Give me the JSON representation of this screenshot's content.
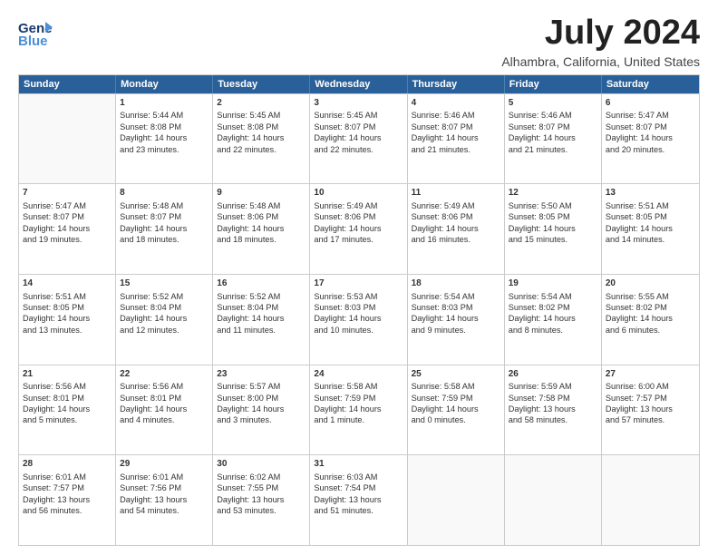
{
  "logo": {
    "line1": "General",
    "line2": "Blue"
  },
  "title": "July 2024",
  "subtitle": "Alhambra, California, United States",
  "days": [
    "Sunday",
    "Monday",
    "Tuesday",
    "Wednesday",
    "Thursday",
    "Friday",
    "Saturday"
  ],
  "weeks": [
    [
      {
        "day": "",
        "content": ""
      },
      {
        "day": "1",
        "content": "Sunrise: 5:44 AM\nSunset: 8:08 PM\nDaylight: 14 hours\nand 23 minutes."
      },
      {
        "day": "2",
        "content": "Sunrise: 5:45 AM\nSunset: 8:08 PM\nDaylight: 14 hours\nand 22 minutes."
      },
      {
        "day": "3",
        "content": "Sunrise: 5:45 AM\nSunset: 8:07 PM\nDaylight: 14 hours\nand 22 minutes."
      },
      {
        "day": "4",
        "content": "Sunrise: 5:46 AM\nSunset: 8:07 PM\nDaylight: 14 hours\nand 21 minutes."
      },
      {
        "day": "5",
        "content": "Sunrise: 5:46 AM\nSunset: 8:07 PM\nDaylight: 14 hours\nand 21 minutes."
      },
      {
        "day": "6",
        "content": "Sunrise: 5:47 AM\nSunset: 8:07 PM\nDaylight: 14 hours\nand 20 minutes."
      }
    ],
    [
      {
        "day": "7",
        "content": "Sunrise: 5:47 AM\nSunset: 8:07 PM\nDaylight: 14 hours\nand 19 minutes."
      },
      {
        "day": "8",
        "content": "Sunrise: 5:48 AM\nSunset: 8:07 PM\nDaylight: 14 hours\nand 18 minutes."
      },
      {
        "day": "9",
        "content": "Sunrise: 5:48 AM\nSunset: 8:06 PM\nDaylight: 14 hours\nand 18 minutes."
      },
      {
        "day": "10",
        "content": "Sunrise: 5:49 AM\nSunset: 8:06 PM\nDaylight: 14 hours\nand 17 minutes."
      },
      {
        "day": "11",
        "content": "Sunrise: 5:49 AM\nSunset: 8:06 PM\nDaylight: 14 hours\nand 16 minutes."
      },
      {
        "day": "12",
        "content": "Sunrise: 5:50 AM\nSunset: 8:05 PM\nDaylight: 14 hours\nand 15 minutes."
      },
      {
        "day": "13",
        "content": "Sunrise: 5:51 AM\nSunset: 8:05 PM\nDaylight: 14 hours\nand 14 minutes."
      }
    ],
    [
      {
        "day": "14",
        "content": "Sunrise: 5:51 AM\nSunset: 8:05 PM\nDaylight: 14 hours\nand 13 minutes."
      },
      {
        "day": "15",
        "content": "Sunrise: 5:52 AM\nSunset: 8:04 PM\nDaylight: 14 hours\nand 12 minutes."
      },
      {
        "day": "16",
        "content": "Sunrise: 5:52 AM\nSunset: 8:04 PM\nDaylight: 14 hours\nand 11 minutes."
      },
      {
        "day": "17",
        "content": "Sunrise: 5:53 AM\nSunset: 8:03 PM\nDaylight: 14 hours\nand 10 minutes."
      },
      {
        "day": "18",
        "content": "Sunrise: 5:54 AM\nSunset: 8:03 PM\nDaylight: 14 hours\nand 9 minutes."
      },
      {
        "day": "19",
        "content": "Sunrise: 5:54 AM\nSunset: 8:02 PM\nDaylight: 14 hours\nand 8 minutes."
      },
      {
        "day": "20",
        "content": "Sunrise: 5:55 AM\nSunset: 8:02 PM\nDaylight: 14 hours\nand 6 minutes."
      }
    ],
    [
      {
        "day": "21",
        "content": "Sunrise: 5:56 AM\nSunset: 8:01 PM\nDaylight: 14 hours\nand 5 minutes."
      },
      {
        "day": "22",
        "content": "Sunrise: 5:56 AM\nSunset: 8:01 PM\nDaylight: 14 hours\nand 4 minutes."
      },
      {
        "day": "23",
        "content": "Sunrise: 5:57 AM\nSunset: 8:00 PM\nDaylight: 14 hours\nand 3 minutes."
      },
      {
        "day": "24",
        "content": "Sunrise: 5:58 AM\nSunset: 7:59 PM\nDaylight: 14 hours\nand 1 minute."
      },
      {
        "day": "25",
        "content": "Sunrise: 5:58 AM\nSunset: 7:59 PM\nDaylight: 14 hours\nand 0 minutes."
      },
      {
        "day": "26",
        "content": "Sunrise: 5:59 AM\nSunset: 7:58 PM\nDaylight: 13 hours\nand 58 minutes."
      },
      {
        "day": "27",
        "content": "Sunrise: 6:00 AM\nSunset: 7:57 PM\nDaylight: 13 hours\nand 57 minutes."
      }
    ],
    [
      {
        "day": "28",
        "content": "Sunrise: 6:01 AM\nSunset: 7:57 PM\nDaylight: 13 hours\nand 56 minutes."
      },
      {
        "day": "29",
        "content": "Sunrise: 6:01 AM\nSunset: 7:56 PM\nDaylight: 13 hours\nand 54 minutes."
      },
      {
        "day": "30",
        "content": "Sunrise: 6:02 AM\nSunset: 7:55 PM\nDaylight: 13 hours\nand 53 minutes."
      },
      {
        "day": "31",
        "content": "Sunrise: 6:03 AM\nSunset: 7:54 PM\nDaylight: 13 hours\nand 51 minutes."
      },
      {
        "day": "",
        "content": ""
      },
      {
        "day": "",
        "content": ""
      },
      {
        "day": "",
        "content": ""
      }
    ]
  ]
}
